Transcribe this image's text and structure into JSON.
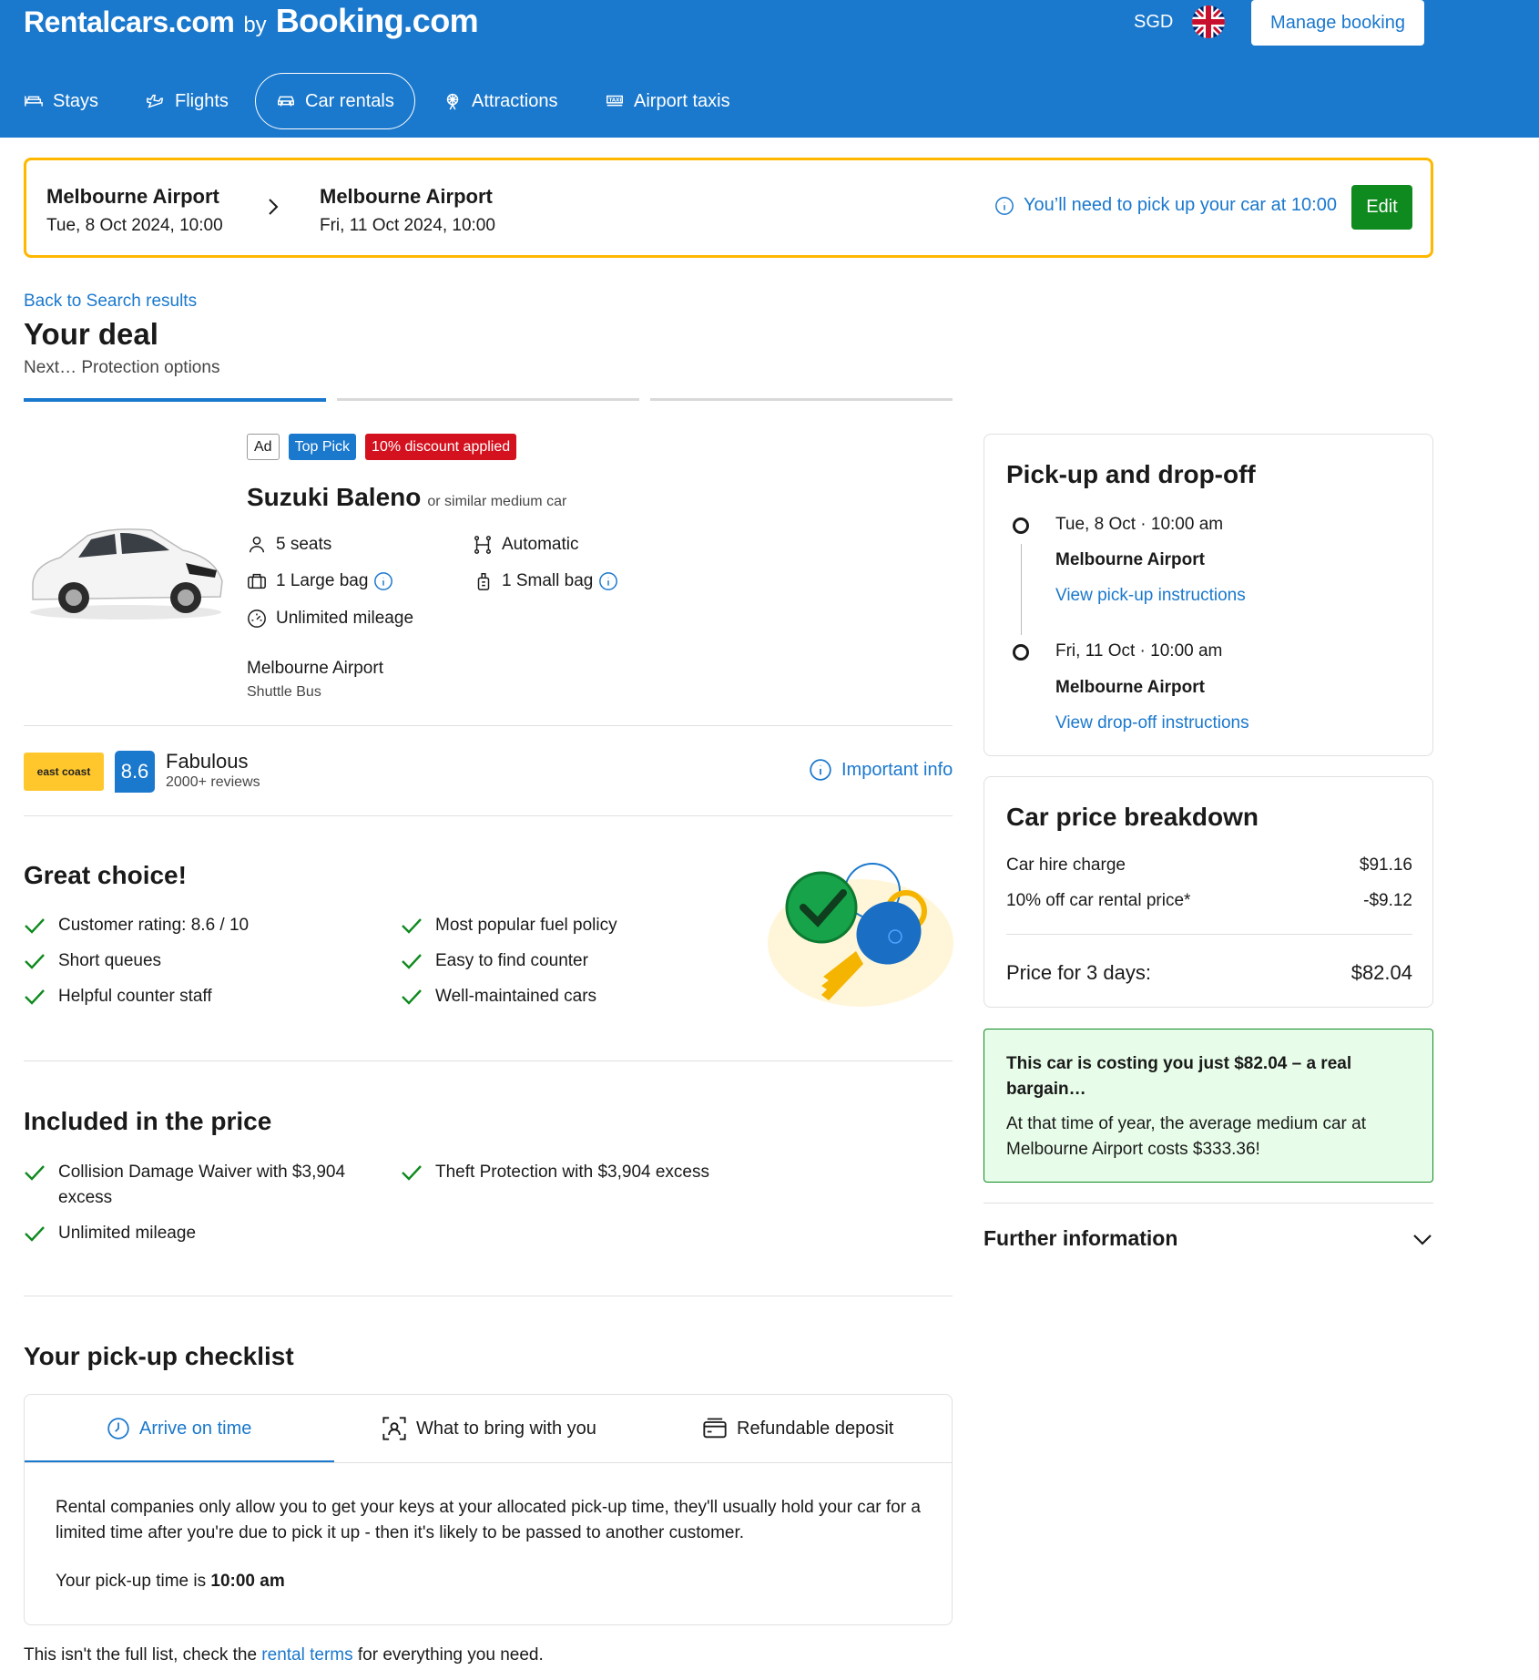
{
  "header": {
    "brand_primary": "Rentalcars.com",
    "brand_by": "by",
    "brand_secondary": "Booking.com",
    "currency": "SGD",
    "manage_booking": "Manage booking",
    "nav": [
      {
        "label": "Stays",
        "icon": "bed-icon"
      },
      {
        "label": "Flights",
        "icon": "plane-icon"
      },
      {
        "label": "Car rentals",
        "icon": "car-icon",
        "active": true
      },
      {
        "label": "Attractions",
        "icon": "ferris-wheel-icon"
      },
      {
        "label": "Airport taxis",
        "icon": "taxi-icon"
      }
    ],
    "colors": {
      "brand_blue": "#1a78cd",
      "accent_yellow": "#ffb700",
      "edit_green": "#0f8a1f"
    }
  },
  "summary": {
    "pickup_location": "Melbourne Airport",
    "pickup_datetime": "Tue, 8 Oct 2024, 10:00",
    "dropoff_location": "Melbourne Airport",
    "dropoff_datetime": "Fri, 11 Oct 2024, 10:00",
    "pickup_note": "You’ll need to pick up your car at 10:00",
    "edit_label": "Edit"
  },
  "deal": {
    "back_link": "Back to Search results",
    "title": "Your deal",
    "next_step": "Next… Protection options",
    "progress_step": 1,
    "progress_total": 3
  },
  "car": {
    "badges": {
      "ad": "Ad",
      "top_pick": "Top Pick",
      "discount": "10% discount applied"
    },
    "name": "Suzuki Baleno",
    "similar": "or similar medium car",
    "specs": {
      "seats": "5 seats",
      "transmission": "Automatic",
      "large_bag": "1 Large bag",
      "small_bag": "1 Small bag",
      "mileage": "Unlimited mileage"
    },
    "location": "Melbourne Airport",
    "location_sub": "Shuttle Bus"
  },
  "supplier": {
    "logo_text": "east coast",
    "score": "8.6",
    "rating_word": "Fabulous",
    "reviews": "2000+ reviews",
    "important_info": "Important info"
  },
  "great_choice": {
    "title": "Great choice!",
    "left": [
      "Customer rating: 8.6 / 10",
      "Short queues",
      "Helpful counter staff"
    ],
    "right": [
      "Most popular fuel policy",
      "Easy to find counter",
      "Well-maintained cars"
    ]
  },
  "included": {
    "title": "Included in the price",
    "left": [
      "Collision Damage Waiver with $3,904 excess",
      "Unlimited mileage"
    ],
    "right": [
      "Theft Protection with $3,904 excess"
    ]
  },
  "checklist": {
    "title": "Your pick-up checklist",
    "tabs": [
      {
        "label": "Arrive on time",
        "icon": "clock-icon",
        "active": true
      },
      {
        "label": "What to bring with you",
        "icon": "id-scan-icon"
      },
      {
        "label": "Refundable deposit",
        "icon": "card-icon"
      }
    ],
    "body": "Rental companies only allow you to get your keys at your allocated pick-up time, they'll usually hold your car for a limited time after you're due to pick it up - then it's likely to be passed to another customer.",
    "time_prefix": "Your pick-up time is ",
    "time_value": "10:00 am",
    "footer_prefix": "This isn't the full list, check the ",
    "footer_link": "rental terms",
    "footer_suffix": " for everything you need."
  },
  "pickup_dropoff": {
    "title": "Pick-up and drop-off",
    "pickup_datetime": "Tue, 8 Oct · 10:00 am",
    "pickup_location": "Melbourne Airport",
    "pickup_link": "View pick-up instructions",
    "dropoff_datetime": "Fri, 11 Oct · 10:00 am",
    "dropoff_location": "Melbourne Airport",
    "dropoff_link": "View drop-off instructions"
  },
  "price": {
    "title": "Car price breakdown",
    "hire_label": "Car hire charge",
    "hire_value": "$91.16",
    "discount_label": "10% off car rental price*",
    "discount_value": "-$9.12",
    "total_label": "Price for 3 days:",
    "total_value": "$82.04"
  },
  "bargain": {
    "title": "This car is costing you just $82.04 – a real bargain…",
    "detail": "At that time of year, the average medium car at Melbourne Airport costs $333.36!"
  },
  "further": {
    "label": "Further information"
  }
}
